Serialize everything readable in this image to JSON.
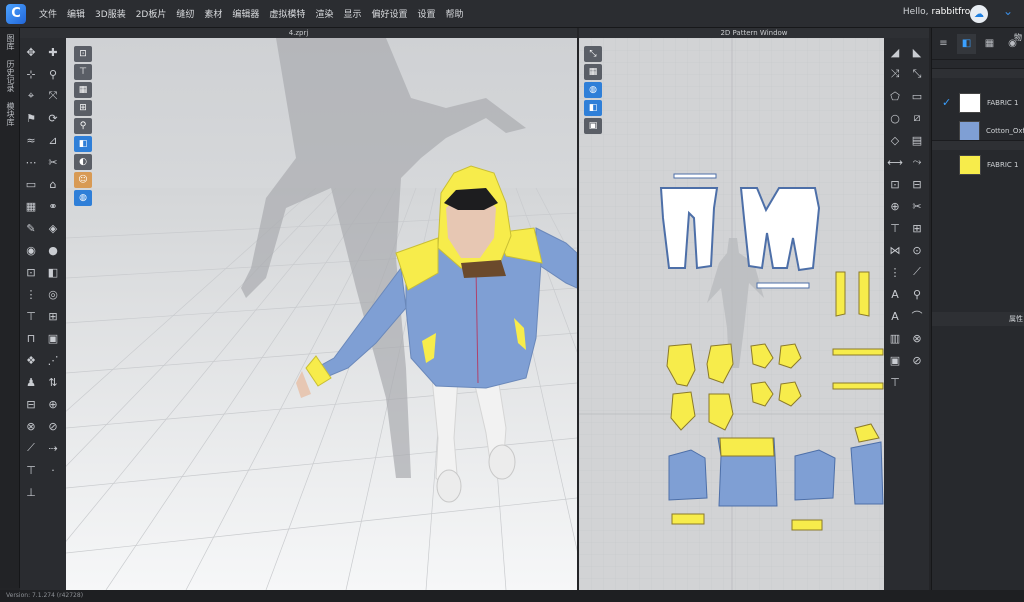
{
  "menu": {
    "logo": "C",
    "items": [
      "文件",
      "编辑",
      "3D服装",
      "2D板片",
      "缝纫",
      "素材",
      "编辑器",
      "虚拟模特",
      "渲染",
      "显示",
      "偏好设置",
      "设置",
      "帮助"
    ],
    "greeting": "Hello,",
    "username": "rabbitfrog"
  },
  "left_tabs": [
    "图库",
    "历史记录",
    "模块库"
  ],
  "view3d": {
    "title": "4.zprj"
  },
  "view2d": {
    "title": "2D Pattern Window"
  },
  "right_panel": {
    "tab_cut_label": "物",
    "fabrics_top": [
      {
        "name": "FABRIC 1",
        "color": "#ffffff",
        "checked": true
      },
      {
        "name": "Cotton_Oxf",
        "color": "#7f9fd4",
        "checked": false
      }
    ],
    "fabrics_bottom": [
      {
        "name": "FABRIC 1",
        "color": "#f7ec4b",
        "checked": false
      }
    ],
    "property_label": "属性"
  },
  "status": {
    "version": "Version: 7.1.274 (r42728)"
  },
  "colors": {
    "accent": "#3aa0ff",
    "yellow": "#f7ec4b",
    "blue": "#7f9fd4",
    "white": "#ffffff"
  }
}
